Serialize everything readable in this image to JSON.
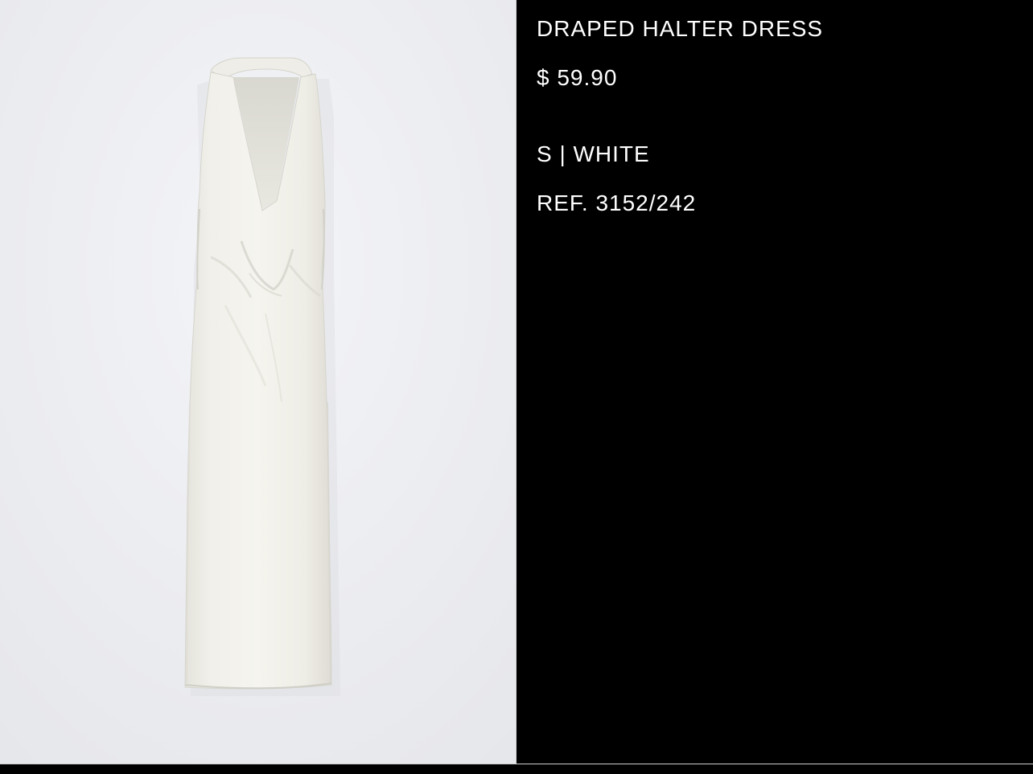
{
  "product": {
    "name": "DRAPED HALTER DRESS",
    "price": "$ 59.90",
    "variant": "S | WHITE",
    "ref": "REF. 3152/242"
  },
  "image": {
    "subject": "white draped halter dress",
    "background_color": "#ecedf1",
    "garment_color": "#f3f2ec"
  },
  "colors": {
    "panel_background": "#000000",
    "text": "#ffffff"
  }
}
